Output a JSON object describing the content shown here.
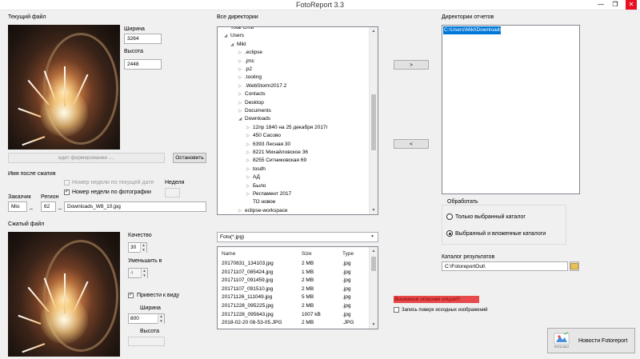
{
  "window": {
    "title": "FotoReport 3.3",
    "minimize_label": "—",
    "maximize_label": "❐",
    "close_label": "✕"
  },
  "current_file": {
    "section_title": "Текущий файл",
    "width_label": "Ширина",
    "width_value": "3264",
    "height_label": "Высота",
    "height_value": "2448",
    "progress_label": "идет формирование ....",
    "stop_button": "Остановить"
  },
  "compressed_name": {
    "section_title": "Имя после сжатия",
    "opt_week_current": "Номер недели по текущей дате",
    "opt_week_photo": "Номер недели по фотографии",
    "week_label": "Неделя",
    "customer_label": "Заказчик",
    "customer_value": "Mio",
    "region_label": "Регион",
    "region_value": "62",
    "filename_value": "Downloads_W8_10.jpg"
  },
  "compressed_file": {
    "section_title": "Сжатый файл",
    "quality_label": "Качество",
    "quality_value": "30",
    "reduce_label": "Уменьшить в",
    "reduce_value": "4",
    "fit_label": "Привести к виду",
    "width_label": "Ширина",
    "width_value": "800",
    "height_label": "Высота"
  },
  "directories": {
    "title": "Все директории",
    "tree": [
      {
        "label": "Total Cmd",
        "level": 0,
        "arrow": ""
      },
      {
        "label": "Users",
        "level": 0,
        "arrow": "◢"
      },
      {
        "label": "Mikl",
        "level": 1,
        "arrow": "◢"
      },
      {
        "label": ".eclipse",
        "level": 2,
        "arrow": "▷"
      },
      {
        "label": ".jmc",
        "level": 2,
        "arrow": "▷"
      },
      {
        "label": ".p2",
        "level": 2,
        "arrow": "▷"
      },
      {
        "label": ".tooling",
        "level": 2,
        "arrow": "▷"
      },
      {
        "label": ".WebStorm2017.2",
        "level": 2,
        "arrow": "▷"
      },
      {
        "label": "Contacts",
        "level": 2,
        "arrow": "▷"
      },
      {
        "label": "Desktop",
        "level": 2,
        "arrow": "▷"
      },
      {
        "label": "Documents",
        "level": 2,
        "arrow": "▷"
      },
      {
        "label": "Downloads",
        "level": 2,
        "arrow": "◢"
      },
      {
        "label": "12пр 1840 на 25 декабря 2017г",
        "level": 3,
        "arrow": "▷"
      },
      {
        "label": "450 Сасово",
        "level": 3,
        "arrow": "▷"
      },
      {
        "label": "6393 Лесная 30",
        "level": 3,
        "arrow": "▷"
      },
      {
        "label": "8221 Михайловское 36",
        "level": 3,
        "arrow": "▷"
      },
      {
        "label": "8255 Ситниковская 69",
        "level": 3,
        "arrow": "▷"
      },
      {
        "label": "tosdh",
        "level": 3,
        "arrow": "▷"
      },
      {
        "label": "АД",
        "level": 3,
        "arrow": "▷"
      },
      {
        "label": "Было",
        "level": 3,
        "arrow": "▷"
      },
      {
        "label": "Регламент 2017",
        "level": 3,
        "arrow": "▷"
      },
      {
        "label": "ТО новое",
        "level": 3,
        "arrow": ""
      },
      {
        "label": "eclipse-workspace",
        "level": 2,
        "arrow": "▷"
      }
    ],
    "add_button": ">",
    "remove_button": "<"
  },
  "file_filter": {
    "value": "Foto(*.jpg)"
  },
  "file_list": {
    "headers": [
      "Name",
      "Size",
      "Type"
    ],
    "rows": [
      [
        "20170831_134103.jpg",
        "2 MB",
        ".jpg"
      ],
      [
        "20171107_085424.jpg",
        "1 MB",
        ".jpg"
      ],
      [
        "20171107_091459.jpg",
        "2 MB",
        ".jpg"
      ],
      [
        "20171107_091510.jpg",
        "2 MB",
        ".jpg"
      ],
      [
        "20171126_111049.jpg",
        "5 MB",
        ".jpg"
      ],
      [
        "20171228_095225.jpg",
        "2 MB",
        ".jpg"
      ],
      [
        "20171228_095643.jpg",
        "1007 kB",
        ".jpg"
      ],
      [
        "2018-02-20 08-53-05.JPG",
        "2 MB",
        ".JPG"
      ]
    ]
  },
  "report_dirs": {
    "title": "Директории отчетов",
    "items": [
      "C:\\Users\\Mikl\\Downloads"
    ]
  },
  "process": {
    "title": "Обработать",
    "opt_selected_only": "Только выбранный каталог",
    "opt_selected_nested": "Выбранный и вложенные каталоги"
  },
  "result_catalog": {
    "label": "Каталог результатов",
    "value": "C:\\FotoreportOut\\"
  },
  "warning": {
    "text": "Внимание опасная опция!!!",
    "overwrite_label": "Запись поверх исходных изображений"
  },
  "news_button": {
    "label": "Новости Fotoreport",
    "logo_caption": "FOTO 2017"
  }
}
